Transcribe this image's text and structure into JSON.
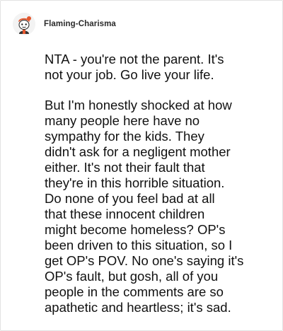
{
  "post": {
    "username": "Flaming-Charisma",
    "avatar_icon": "avatar-character-icon",
    "paragraphs": [
      "NTA - you're not the parent. It's\nnot your job. Go live your life.",
      "But I'm honestly shocked at how\nmany people here have no\nsympathy for the kids. They\ndidn't ask for a negligent mother\neither. It's not their fault that\nthey're in this horrible situation.\nDo none of you feel bad at all\nthat these innocent children\nmight become homeless? OP's\nbeen driven to this situation, so I\nget OP's POV. No one's saying it's\nOP's fault, but gosh, all of you\npeople in the comments are so\napathetic and heartless; it's sad."
    ]
  },
  "colors": {
    "card_border": "#e2e2e2",
    "username": "#2a2a2a",
    "text": "#111111",
    "avatar_accent": "#e4572e"
  }
}
